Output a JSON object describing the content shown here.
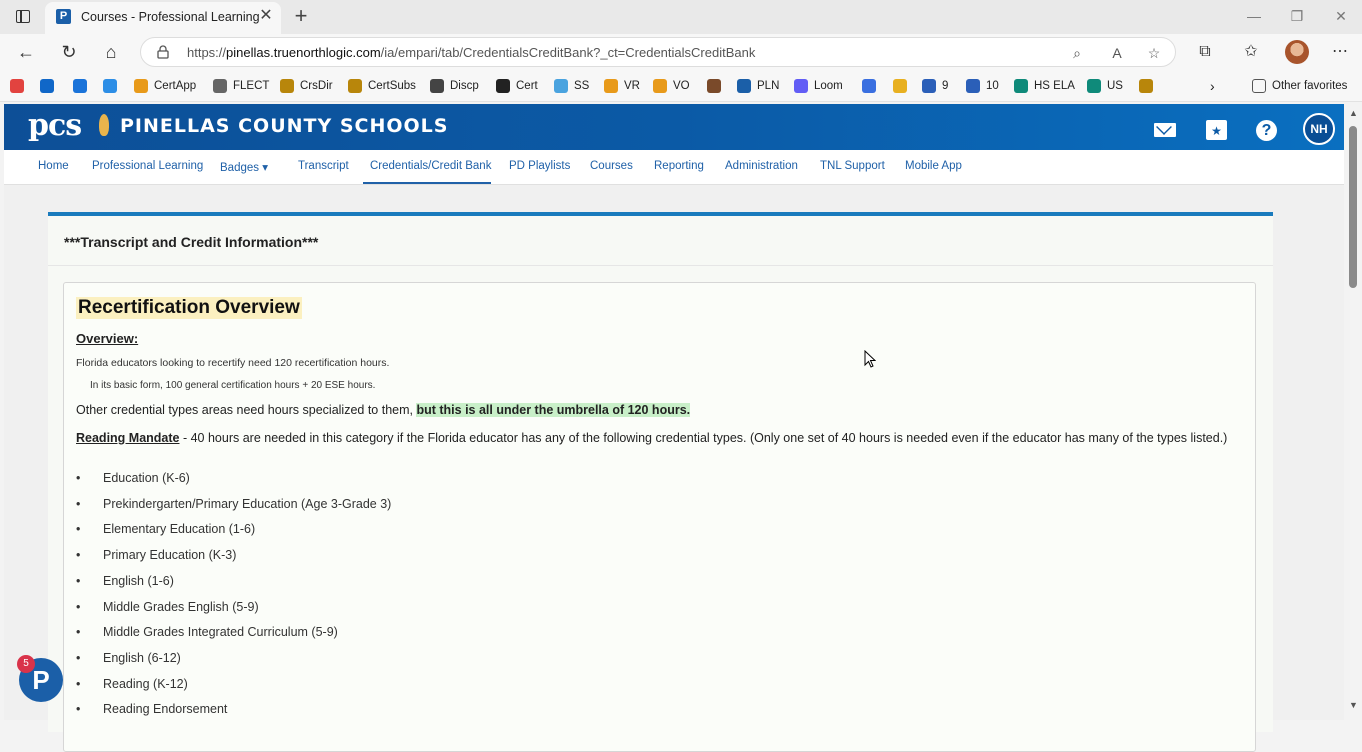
{
  "browser": {
    "tab_title": "Courses - Professional Learning",
    "tab_close": "✕",
    "new_tab": "+",
    "url_prefix": "https://",
    "url_domain": "pinellas.truenorthlogic.com",
    "url_path": "/ia/empari/tab/CredentialsCreditBank?_ct=CredentialsCreditBank",
    "window_controls": [
      "—",
      "❐",
      "✕"
    ]
  },
  "favorites": [
    {
      "label": "",
      "color": "#e2433f"
    },
    {
      "label": "",
      "color": "#1067c8"
    },
    {
      "label": "",
      "color": "#1a73d9"
    },
    {
      "label": "",
      "color": "#2d8ee6"
    },
    {
      "label": "CertApp",
      "color": "#e89a1a"
    },
    {
      "label": "FLECT",
      "color": "#666666"
    },
    {
      "label": "CrsDir",
      "color": "#b8860b"
    },
    {
      "label": "CertSubs",
      "color": "#b8860b"
    },
    {
      "label": "Discp",
      "color": "#444444"
    },
    {
      "label": "Cert",
      "color": "#222222"
    },
    {
      "label": "SS",
      "color": "#4aa3df"
    },
    {
      "label": "VR",
      "color": "#e89a1a"
    },
    {
      "label": "VO",
      "color": "#e89a1a"
    },
    {
      "label": "",
      "color": "#7a4a2a"
    },
    {
      "label": "PLN",
      "color": "#1b5fa8"
    },
    {
      "label": "Loom",
      "color": "#625df5"
    },
    {
      "label": "",
      "color": "#3a6fe0"
    },
    {
      "label": "",
      "color": "#e8b020"
    },
    {
      "label": "9",
      "color": "#2b5fb8"
    },
    {
      "label": "10",
      "color": "#2b5fb8"
    },
    {
      "label": "HS ELA",
      "color": "#0f8a7a"
    },
    {
      "label": "US",
      "color": "#0f8a7a"
    },
    {
      "label": "",
      "color": "#b8860b"
    }
  ],
  "other_favorites": "Other favorites",
  "site": {
    "logo": "pcs",
    "name": "PINELLAS COUNTY SCHOOLS",
    "calendar_glyph": "★",
    "help_glyph": "?",
    "user_initials": "NH"
  },
  "nav": [
    {
      "label": "Home"
    },
    {
      "label": "Professional Learning"
    },
    {
      "label": "Badges ▾"
    },
    {
      "label": "Transcript"
    },
    {
      "label": "Credentials/Credit Bank"
    },
    {
      "label": "PD Playlists"
    },
    {
      "label": "Courses"
    },
    {
      "label": "Reporting"
    },
    {
      "label": "Administration"
    },
    {
      "label": "TNL Support"
    },
    {
      "label": "Mobile App"
    }
  ],
  "card": {
    "title": "***Transcript and Credit Information***",
    "heading": "Recertification Overview",
    "overview_label": "Overview:",
    "line1": "Florida educators looking to recertify need 120 recertification hours.",
    "line2": "In its basic form, 100 general certification hours + 20 ESE hours.",
    "line3_plain": "Other credential types areas need hours specialized to them, ",
    "line3_highlight": "but this is all under the umbrella of 120 hours.",
    "mandate_label": "Reading Mandate",
    "mandate_text": " - 40 hours are needed in this category if the Florida educator has any of the following credential types.  (Only one set of 40 hours is needed even if the educator has many of the types listed.)",
    "credentials": [
      "Education (K-6)",
      "Prekindergarten/Primary Education (Age 3-Grade 3)",
      "Elementary Education (1-6)",
      "Primary Education (K-3)",
      "English (1-6)",
      "Middle Grades English (5-9)",
      "Middle Grades Integrated Curriculum (5-9)",
      "English (6-12)",
      "Reading (K-12)",
      "Reading Endorsement"
    ],
    "bullet": "•"
  },
  "widget": {
    "badge_count": "5",
    "glyph": "P"
  }
}
